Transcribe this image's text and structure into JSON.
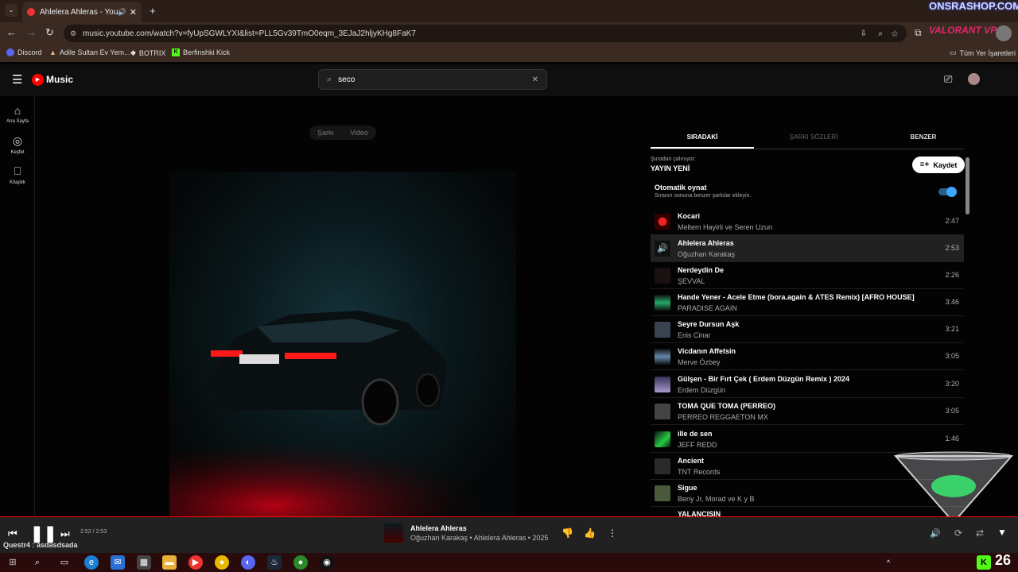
{
  "browser": {
    "tab_title": "Ahlelera Ahleras - YouTube",
    "url": "music.youtube.com/watch?v=fyUpSGWLYXI&list=PLL5Gv39TmO0eqm_3EJaJ2hljyKHg8FaK7",
    "bookmarks": [
      "Discord",
      "Adile Sultan Ev Yem...",
      "BOTRIX",
      "Berfinshki Kick"
    ],
    "bookmarks_folder": "Tüm Yer İşaretleri",
    "overlay_watermark": "ONSRASHOP.COM",
    "overlay_ad": "VALORANT VP"
  },
  "app": {
    "logo_text": "Music",
    "search_value": "seco",
    "sidebar": [
      {
        "label": "Ana Sayfa",
        "icon": "home-icon"
      },
      {
        "label": "Keşfet",
        "icon": "explore-icon"
      },
      {
        "label": "Kitaplık",
        "icon": "library-icon"
      }
    ],
    "toggle": {
      "song": "Şarkı",
      "video": "Video"
    }
  },
  "queue": {
    "tabs": [
      "SIRADAKİ",
      "ŞARKI SÖZLERİ",
      "BENZER"
    ],
    "playing_from_label": "Şuradan çalınıyor:",
    "playlist_name": "YAYIN YENİ",
    "save_label": "Kaydet",
    "autoplay_title": "Otomatik oynat",
    "autoplay_sub": "Sıranın sonuna benzer şarkılar ekleyin.",
    "autoplay_on": true,
    "tracks": [
      {
        "title": "Kocari",
        "artist": "Meltem Hayirli ve Seren Uzun",
        "duration": "2:47"
      },
      {
        "title": "Ahlelera Ahleras",
        "artist": "Oğuzhan Karakaş",
        "duration": "2:53"
      },
      {
        "title": "Nerdeydin De",
        "artist": "ŞEVVAL",
        "duration": "2:26"
      },
      {
        "title": "Hande Yener - Acele Etme (bora.again & ΛTES Remix) [AFRO HOUSE]",
        "artist": "PARADISE AGAIN",
        "duration": "3:46"
      },
      {
        "title": "Seyre Dursun Aşk",
        "artist": "Enis Cinar",
        "duration": "3:21"
      },
      {
        "title": "Vicdanın Affetsin",
        "artist": "Merve Özbey",
        "duration": "3:05"
      },
      {
        "title": "Gülşen - Bir Fırt Çek ( Erdem Düzgün Remix ) 2024",
        "artist": "Erdem Düzgün",
        "duration": "3:20"
      },
      {
        "title": "TOMA QUE TOMA (PERREO)",
        "artist": "PERREO REGGAETON MX",
        "duration": "3:05"
      },
      {
        "title": "ille de sen",
        "artist": "JEFF REDD",
        "duration": "1:46"
      },
      {
        "title": "Ancient",
        "artist": "TNT Records",
        "duration": ""
      },
      {
        "title": "Sigue",
        "artist": "Beny Jr, Morad ve K y B",
        "duration": ""
      },
      {
        "title": "YALANCISIN",
        "artist": "",
        "duration": ""
      }
    ]
  },
  "player": {
    "time": "2:52 / 2:53",
    "progress": 0.994,
    "title": "Ahlelera Ahleras",
    "subtitle": "Oğuzhan Karakaş • Ahlelera Ahleras • 2025"
  },
  "chat_overlay": "Questr4 : asdasdsada",
  "overlay_number": "26",
  "colors": {
    "accent": "#ff0000",
    "toggle": "#3ea6ff"
  }
}
